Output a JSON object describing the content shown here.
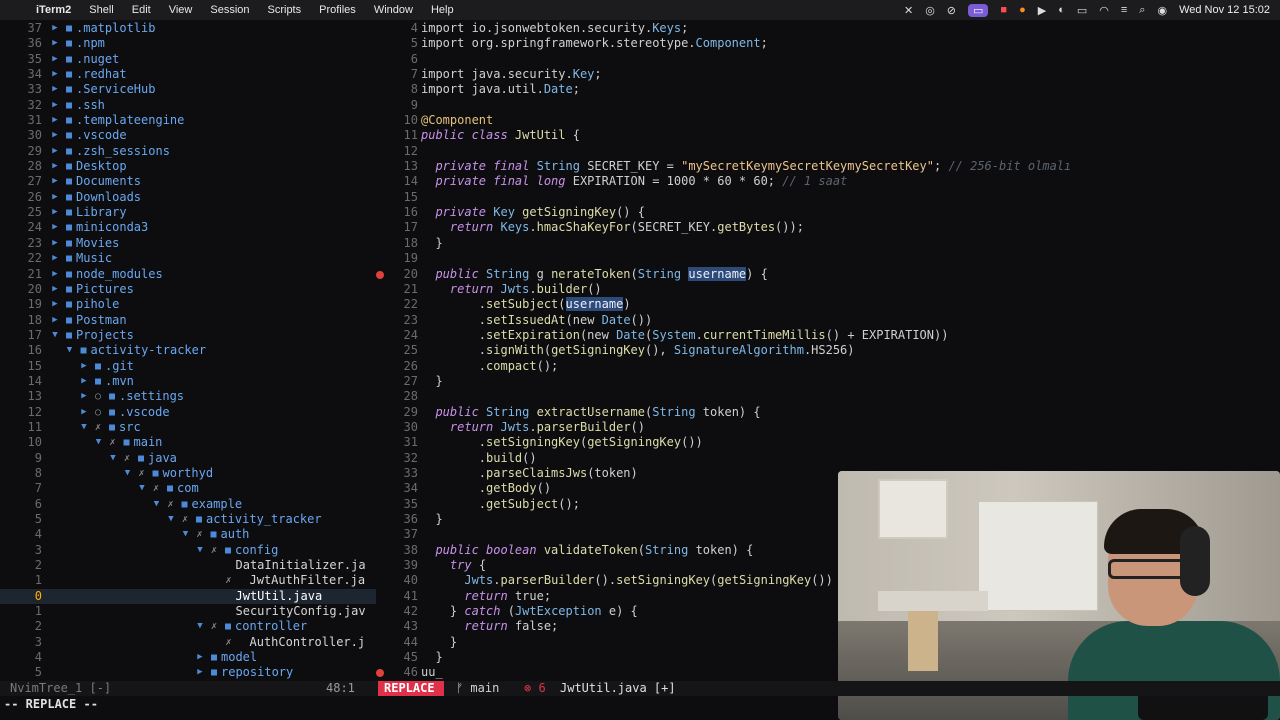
{
  "menubar": {
    "app": "iTerm2",
    "items": [
      "Shell",
      "Edit",
      "View",
      "Session",
      "Scripts",
      "Profiles",
      "Window",
      "Help"
    ],
    "clock": "Wed Nov 12  15:02"
  },
  "tree": {
    "rows": [
      {
        "ln": "37",
        "depth": 0,
        "kind": "dir",
        "name": ".matplotlib"
      },
      {
        "ln": "36",
        "depth": 0,
        "kind": "dir",
        "name": ".npm"
      },
      {
        "ln": "35",
        "depth": 0,
        "kind": "dir",
        "name": ".nuget"
      },
      {
        "ln": "34",
        "depth": 0,
        "kind": "dir",
        "name": ".redhat"
      },
      {
        "ln": "33",
        "depth": 0,
        "kind": "dir",
        "name": ".ServiceHub"
      },
      {
        "ln": "32",
        "depth": 0,
        "kind": "dir",
        "name": ".ssh"
      },
      {
        "ln": "31",
        "depth": 0,
        "kind": "dir",
        "name": ".templateengine"
      },
      {
        "ln": "30",
        "depth": 0,
        "kind": "dir",
        "name": ".vscode"
      },
      {
        "ln": "29",
        "depth": 0,
        "kind": "dir",
        "name": ".zsh_sessions"
      },
      {
        "ln": "28",
        "depth": 0,
        "kind": "dir",
        "name": "Desktop"
      },
      {
        "ln": "27",
        "depth": 0,
        "kind": "dir",
        "name": "Documents"
      },
      {
        "ln": "26",
        "depth": 0,
        "kind": "dir",
        "name": "Downloads"
      },
      {
        "ln": "25",
        "depth": 0,
        "kind": "dir",
        "name": "Library"
      },
      {
        "ln": "24",
        "depth": 0,
        "kind": "dir",
        "name": "miniconda3"
      },
      {
        "ln": "23",
        "depth": 0,
        "kind": "dir",
        "name": "Movies"
      },
      {
        "ln": "22",
        "depth": 0,
        "kind": "dir",
        "name": "Music"
      },
      {
        "ln": "21",
        "depth": 0,
        "kind": "dir",
        "name": "node_modules"
      },
      {
        "ln": "20",
        "depth": 0,
        "kind": "dir",
        "name": "Pictures"
      },
      {
        "ln": "19",
        "depth": 0,
        "kind": "dir",
        "name": "pihole"
      },
      {
        "ln": "18",
        "depth": 0,
        "kind": "dir",
        "name": "Postman"
      },
      {
        "ln": "17",
        "depth": 0,
        "kind": "dir-open",
        "name": "Projects"
      },
      {
        "ln": "16",
        "depth": 1,
        "kind": "dir-open",
        "name": "activity-tracker"
      },
      {
        "ln": "15",
        "depth": 2,
        "kind": "dir",
        "name": ".git"
      },
      {
        "ln": "14",
        "depth": 2,
        "kind": "dir",
        "name": ".mvn"
      },
      {
        "ln": "13",
        "depth": 2,
        "kind": "dir-hidden",
        "name": ".settings"
      },
      {
        "ln": "12",
        "depth": 2,
        "kind": "dir-hidden",
        "name": ".vscode"
      },
      {
        "ln": "11",
        "depth": 2,
        "kind": "dir-open-x",
        "name": "src"
      },
      {
        "ln": "10",
        "depth": 3,
        "kind": "dir-open-x",
        "name": "main"
      },
      {
        "ln": "9",
        "depth": 4,
        "kind": "dir-open-x",
        "name": "java"
      },
      {
        "ln": "8",
        "depth": 5,
        "kind": "dir-open-x",
        "name": "worthyd"
      },
      {
        "ln": "7",
        "depth": 6,
        "kind": "dir-open-x",
        "name": "com"
      },
      {
        "ln": "6",
        "depth": 7,
        "kind": "dir-open-x",
        "name": "example"
      },
      {
        "ln": "5",
        "depth": 8,
        "kind": "dir-open-x",
        "name": "activity_tracker"
      },
      {
        "ln": "4",
        "depth": 9,
        "kind": "dir-open-x",
        "name": "auth"
      },
      {
        "ln": "3",
        "depth": 10,
        "kind": "dir-open-x",
        "name": "config"
      },
      {
        "ln": "2",
        "depth": 11,
        "kind": "file",
        "name": "DataInitializer.ja"
      },
      {
        "ln": "1",
        "depth": 11,
        "kind": "file-x",
        "name": "JwtAuthFilter.ja"
      },
      {
        "ln": "0",
        "depth": 11,
        "kind": "file-cur",
        "name": "JwtUtil.java"
      },
      {
        "ln": "1",
        "depth": 11,
        "kind": "file",
        "name": "SecurityConfig.jav"
      },
      {
        "ln": "2",
        "depth": 10,
        "kind": "dir-open-x",
        "name": "controller"
      },
      {
        "ln": "3",
        "depth": 11,
        "kind": "file-x",
        "name": "AuthController.j"
      },
      {
        "ln": "4",
        "depth": 10,
        "kind": "dir",
        "name": "model"
      },
      {
        "ln": "5",
        "depth": 10,
        "kind": "dir",
        "name": "repository"
      }
    ]
  },
  "editor": {
    "lines": [
      {
        "n": "4",
        "segs": [
          [
            "",
            "import io.jsonwebtoken.security."
          ],
          [
            "ty",
            "Keys"
          ],
          [
            "",
            ";"
          ]
        ]
      },
      {
        "n": "5",
        "segs": [
          [
            "",
            "import org.springframework.stereotype."
          ],
          [
            "ty",
            "Component"
          ],
          [
            "",
            ";"
          ]
        ]
      },
      {
        "n": "6",
        "segs": []
      },
      {
        "n": "7",
        "segs": [
          [
            "",
            "import java.security."
          ],
          [
            "ty",
            "Key"
          ],
          [
            "",
            ";"
          ]
        ]
      },
      {
        "n": "8",
        "segs": [
          [
            "",
            "import java.util."
          ],
          [
            "ty",
            "Date"
          ],
          [
            "",
            ";"
          ]
        ]
      },
      {
        "n": "9",
        "segs": []
      },
      {
        "n": "10",
        "segs": [
          [
            "at",
            "@Component"
          ]
        ]
      },
      {
        "n": "11",
        "segs": [
          [
            "kw",
            "public class "
          ],
          [
            "fn",
            "JwtUtil"
          ],
          [
            "",
            " {"
          ]
        ]
      },
      {
        "n": "12",
        "segs": []
      },
      {
        "n": "13",
        "segs": [
          [
            "",
            "  "
          ],
          [
            "kw",
            "private final "
          ],
          [
            "ty",
            "String "
          ],
          [
            "",
            "SECRET_KEY = "
          ],
          [
            "st",
            "\"mySecretKeymySecretKeymySecretKey\""
          ],
          [
            "",
            "; "
          ],
          [
            "cm",
            "// 256-bit olmalı"
          ]
        ]
      },
      {
        "n": "14",
        "segs": [
          [
            "",
            "  "
          ],
          [
            "kw",
            "private final "
          ],
          [
            "kw",
            "long "
          ],
          [
            "",
            "EXPIRATION = 1000 * 60 * 60; "
          ],
          [
            "cm",
            "// 1 saat"
          ]
        ]
      },
      {
        "n": "15",
        "segs": []
      },
      {
        "n": "16",
        "segs": [
          [
            "",
            "  "
          ],
          [
            "kw",
            "private "
          ],
          [
            "ty",
            "Key "
          ],
          [
            "fn",
            "getSigningKey"
          ],
          [
            "",
            "() {"
          ]
        ]
      },
      {
        "n": "17",
        "segs": [
          [
            "",
            "    "
          ],
          [
            "kw",
            "return "
          ],
          [
            "ty",
            "Keys"
          ],
          [
            "",
            "."
          ],
          [
            "fn",
            "hmacShaKeyFor"
          ],
          [
            "",
            "(SECRET_KEY."
          ],
          [
            "fn",
            "getBytes"
          ],
          [
            "",
            "());"
          ]
        ]
      },
      {
        "n": "18",
        "segs": [
          [
            "",
            "  }"
          ]
        ]
      },
      {
        "n": "19",
        "segs": []
      },
      {
        "n": "20",
        "err": true,
        "segs": [
          [
            "",
            "  "
          ],
          [
            "kw",
            "public "
          ],
          [
            "ty",
            "String "
          ],
          [
            "",
            "g "
          ],
          [
            "fn",
            "nerateToken"
          ],
          [
            "",
            "("
          ],
          [
            "ty",
            "String "
          ],
          [
            "hl",
            "username"
          ],
          [
            "",
            ") {"
          ]
        ]
      },
      {
        "n": "21",
        "segs": [
          [
            "",
            "    "
          ],
          [
            "kw",
            "return "
          ],
          [
            "ty",
            "Jwts"
          ],
          [
            "",
            "."
          ],
          [
            "fn",
            "builder"
          ],
          [
            "",
            "()"
          ]
        ]
      },
      {
        "n": "22",
        "segs": [
          [
            "",
            "        ."
          ],
          [
            "fn",
            "setSubject"
          ],
          [
            "",
            "("
          ],
          [
            "hl",
            "username"
          ],
          [
            "",
            ")"
          ]
        ]
      },
      {
        "n": "23",
        "segs": [
          [
            "",
            "        ."
          ],
          [
            "fn",
            "setIssuedAt"
          ],
          [
            "",
            "(new "
          ],
          [
            "ty",
            "Date"
          ],
          [
            "",
            "())"
          ]
        ]
      },
      {
        "n": "24",
        "segs": [
          [
            "",
            "        ."
          ],
          [
            "fn",
            "setExpiration"
          ],
          [
            "",
            "(new "
          ],
          [
            "ty",
            "Date"
          ],
          [
            "",
            "("
          ],
          [
            "ty",
            "System"
          ],
          [
            "",
            "."
          ],
          [
            "fn",
            "currentTimeMillis"
          ],
          [
            "",
            "() + EXPIRATION))"
          ]
        ]
      },
      {
        "n": "25",
        "segs": [
          [
            "",
            "        ."
          ],
          [
            "fn",
            "signWith"
          ],
          [
            "",
            "("
          ],
          [
            "fn",
            "getSigningKey"
          ],
          [
            "",
            "(), "
          ],
          [
            "ty",
            "SignatureAlgorithm"
          ],
          [
            "",
            ".HS256)"
          ]
        ]
      },
      {
        "n": "26",
        "segs": [
          [
            "",
            "        ."
          ],
          [
            "fn",
            "compact"
          ],
          [
            "",
            "();"
          ]
        ]
      },
      {
        "n": "27",
        "segs": [
          [
            "",
            "  }"
          ]
        ]
      },
      {
        "n": "28",
        "segs": []
      },
      {
        "n": "29",
        "segs": [
          [
            "",
            "  "
          ],
          [
            "kw",
            "public "
          ],
          [
            "ty",
            "String "
          ],
          [
            "fn",
            "extractUsername"
          ],
          [
            "",
            "("
          ],
          [
            "ty",
            "String "
          ],
          [
            "",
            "token) {"
          ]
        ]
      },
      {
        "n": "30",
        "segs": [
          [
            "",
            "    "
          ],
          [
            "kw",
            "return "
          ],
          [
            "ty",
            "Jwts"
          ],
          [
            "",
            "."
          ],
          [
            "fn",
            "parserBuilder"
          ],
          [
            "",
            "()"
          ]
        ]
      },
      {
        "n": "31",
        "segs": [
          [
            "",
            "        ."
          ],
          [
            "fn",
            "setSigningKey"
          ],
          [
            "",
            "("
          ],
          [
            "fn",
            "getSigningKey"
          ],
          [
            "",
            "())"
          ]
        ]
      },
      {
        "n": "32",
        "segs": [
          [
            "",
            "        ."
          ],
          [
            "fn",
            "build"
          ],
          [
            "",
            "()"
          ]
        ]
      },
      {
        "n": "33",
        "segs": [
          [
            "",
            "        ."
          ],
          [
            "fn",
            "parseClaimsJws"
          ],
          [
            "",
            "(token)"
          ]
        ]
      },
      {
        "n": "34",
        "segs": [
          [
            "",
            "        ."
          ],
          [
            "fn",
            "getBody"
          ],
          [
            "",
            "()"
          ]
        ]
      },
      {
        "n": "35",
        "segs": [
          [
            "",
            "        ."
          ],
          [
            "fn",
            "getSubject"
          ],
          [
            "",
            "();"
          ]
        ]
      },
      {
        "n": "36",
        "segs": [
          [
            "",
            "  }"
          ]
        ]
      },
      {
        "n": "37",
        "segs": []
      },
      {
        "n": "38",
        "segs": [
          [
            "",
            "  "
          ],
          [
            "kw",
            "public "
          ],
          [
            "kw",
            "boolean "
          ],
          [
            "fn",
            "validateToken"
          ],
          [
            "",
            "("
          ],
          [
            "ty",
            "String "
          ],
          [
            "",
            "token) {"
          ]
        ]
      },
      {
        "n": "39",
        "segs": [
          [
            "",
            "    "
          ],
          [
            "kw",
            "try"
          ],
          [
            "",
            " {"
          ]
        ]
      },
      {
        "n": "40",
        "segs": [
          [
            "",
            "      "
          ],
          [
            "ty",
            "Jwts"
          ],
          [
            "",
            "."
          ],
          [
            "fn",
            "parserBuilder"
          ],
          [
            "",
            "()."
          ],
          [
            "fn",
            "setSigningKey"
          ],
          [
            "",
            "("
          ],
          [
            "fn",
            "getSigningKey"
          ],
          [
            "",
            "())"
          ]
        ]
      },
      {
        "n": "41",
        "segs": [
          [
            "",
            "      "
          ],
          [
            "kw",
            "return "
          ],
          [
            "",
            "true;"
          ]
        ]
      },
      {
        "n": "42",
        "segs": [
          [
            "",
            "    } "
          ],
          [
            "kw",
            "catch "
          ],
          [
            "",
            "("
          ],
          [
            "ty",
            "JwtException "
          ],
          [
            "",
            "e) {"
          ]
        ]
      },
      {
        "n": "43",
        "segs": [
          [
            "",
            "      "
          ],
          [
            "kw",
            "return "
          ],
          [
            "",
            "false;"
          ]
        ]
      },
      {
        "n": "44",
        "segs": [
          [
            "",
            "    }"
          ]
        ]
      },
      {
        "n": "45",
        "segs": [
          [
            "",
            "  }"
          ]
        ]
      },
      {
        "n": "46",
        "err": true,
        "segs": [
          [
            "",
            "uu_"
          ]
        ]
      }
    ]
  },
  "statusline": {
    "tree_label": "NvimTree_1 [-]",
    "position": "48:1",
    "mode": "REPLACE",
    "branch": "ᚠ main",
    "errors": "⊗ 6",
    "file": "JwtUtil.java  [+]"
  },
  "cmdline": "-- REPLACE --"
}
